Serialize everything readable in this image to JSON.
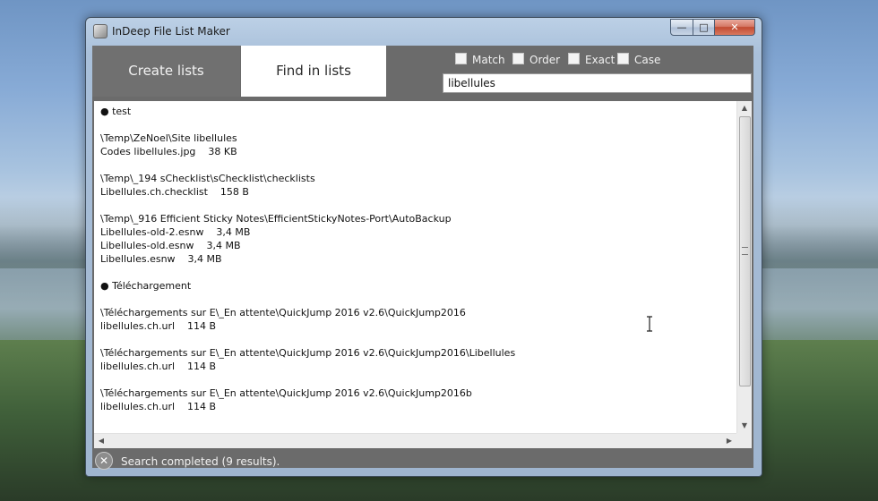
{
  "window": {
    "title": "InDeep File List Maker",
    "minimize_glyph": "—",
    "maximize_glyph": "□",
    "close_glyph": "✕"
  },
  "tabs": {
    "create_label": "Create lists",
    "find_label": "Find in lists",
    "active": "Find in lists"
  },
  "options": {
    "match_label": "Match",
    "order_label": "Order",
    "exact_label": "Exact",
    "case_label": "Case",
    "match_checked": false,
    "order_checked": false,
    "exact_checked": false,
    "case_checked": false
  },
  "search": {
    "value": "libellules"
  },
  "results": {
    "lines": [
      "● test",
      "",
      "\\Temp\\ZeNoel\\Site libellules",
      "Codes libellules.jpg    38 KB",
      "",
      "\\Temp\\_194 sChecklist\\sChecklist\\checklists",
      "Libellules.ch.checklist    158 B",
      "",
      "\\Temp\\_916 Efficient Sticky Notes\\EfficientStickyNotes-Port\\AutoBackup",
      "Libellules-old-2.esnw    3,4 MB",
      "Libellules-old.esnw    3,4 MB",
      "Libellules.esnw    3,4 MB",
      "",
      "● Téléchargement",
      "",
      "\\Téléchargements sur E\\_En attente\\QuickJump 2016 v2.6\\QuickJump2016",
      "libellules.ch.url    114 B",
      "",
      "\\Téléchargements sur E\\_En attente\\QuickJump 2016 v2.6\\QuickJump2016\\Libellules",
      "libellules.ch.url    114 B",
      "",
      "\\Téléchargements sur E\\_En attente\\QuickJump 2016 v2.6\\QuickJump2016b",
      "libellules.ch.url    114 B"
    ]
  },
  "scrollbars": {
    "up_glyph": "▲",
    "down_glyph": "▼",
    "left_glyph": "◀",
    "right_glyph": "▶"
  },
  "status": {
    "icon": "close-circle-icon",
    "icon_glyph": "✕",
    "text": "Search completed (9 results)."
  }
}
